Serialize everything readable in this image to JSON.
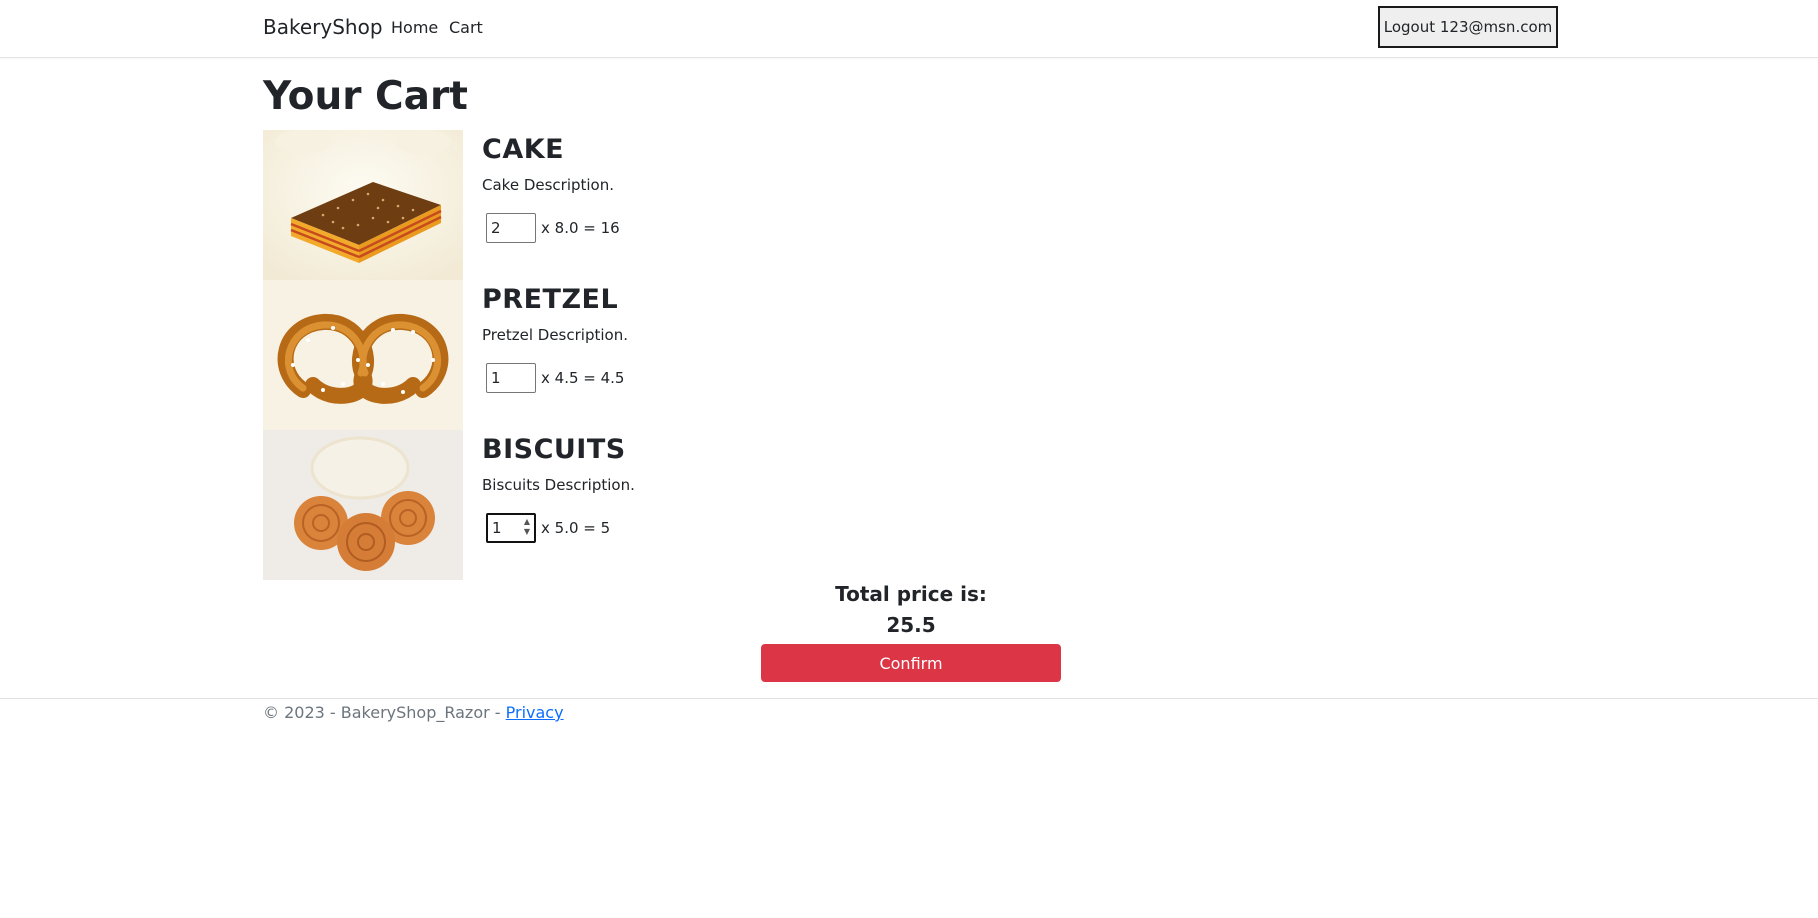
{
  "navbar": {
    "brand": "BakeryShop",
    "links": [
      {
        "label": "Home"
      },
      {
        "label": "Cart"
      }
    ],
    "logout_label": "Logout 123@msn.com"
  },
  "page": {
    "title": "Your Cart"
  },
  "cart": {
    "items": [
      {
        "name": "CAKE",
        "description": "Cake Description.",
        "quantity": "2",
        "price_line": "x 8.0 = 16"
      },
      {
        "name": "PRETZEL",
        "description": "Pretzel Description.",
        "quantity": "1",
        "price_line": "x 4.5 = 4.5"
      },
      {
        "name": "BISCUITS",
        "description": "Biscuits Description.",
        "quantity": "1",
        "price_line": "x 5.0 = 5"
      }
    ],
    "total_label": "Total price is:",
    "total_value": "25.5",
    "confirm_label": "Confirm"
  },
  "footer": {
    "text": "© 2023 - BakeryShop_Razor - ",
    "privacy_link": "Privacy"
  },
  "colors": {
    "confirm": "#dc3545",
    "link": "#0d6efd"
  }
}
